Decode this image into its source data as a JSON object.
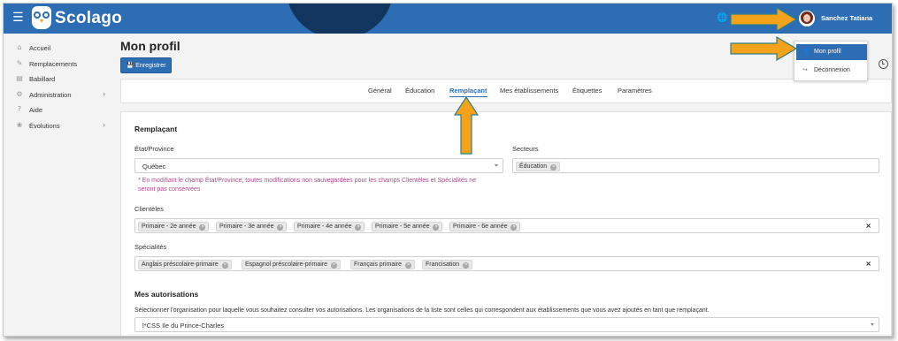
{
  "app": {
    "logo_text": "Scolago",
    "user_name": "Sanchez Tatiana"
  },
  "sidebar": {
    "items": [
      {
        "label": "Accueil",
        "icon": "home-icon",
        "has_submenu": false
      },
      {
        "label": "Remplacements",
        "icon": "pencil-icon",
        "has_submenu": false
      },
      {
        "label": "Babillard",
        "icon": "board-icon",
        "has_submenu": false
      },
      {
        "label": "Administration",
        "icon": "gear-icon",
        "has_submenu": true
      },
      {
        "label": "Aide",
        "icon": "question-icon",
        "has_submenu": false
      },
      {
        "label": "Évolutions",
        "icon": "sprout-icon",
        "has_submenu": true
      }
    ]
  },
  "page": {
    "title": "Mon profil",
    "save_label": "Enregistrer"
  },
  "tabs": [
    {
      "label": "Général",
      "active": false
    },
    {
      "label": "Éducation",
      "active": false
    },
    {
      "label": "Remplaçant",
      "active": true
    },
    {
      "label": "Mes établissements",
      "active": false
    },
    {
      "label": "Étiquettes",
      "active": false
    },
    {
      "label": "Paramètres",
      "active": false
    }
  ],
  "form": {
    "section_title": "Remplaçant",
    "state_label": "État/Province",
    "state_value": "Québec",
    "state_helper_1": "* En modifiant le champ État/Province, toutes modifications non sauvegardées pour les champs Clientèles et Spécialités ne",
    "state_helper_2": "seront pas conservées",
    "sectors_label": "Secteurs",
    "sectors": [
      "Éducation"
    ],
    "clienteles_label": "Clientèles",
    "clienteles": [
      "Primaire - 2e année",
      "Primaire - 3e année",
      "Primaire - 4e année",
      "Primaire - 5e année",
      "Primaire - 6e année"
    ],
    "specialities_label": "Spécialités",
    "specialities": [
      "Anglais préscolaire-primaire",
      "Espagnol préscolaire-primaire",
      "Français primaire",
      "Francisation"
    ]
  },
  "authorizations": {
    "title": "Mes autorisations",
    "description": "Sélectionner l'organisation pour laquelle vous souhaitez consulter vos autorisations. Les organisations de la liste sont celles qui correspondent aux établissements que vous avez ajoutés en tant que remplaçant.",
    "org_value": "l*CSS Ile du Prince-Charles"
  },
  "user_menu": {
    "items": [
      {
        "label": "Mon profil",
        "active": true
      },
      {
        "label": "Déconnexion",
        "active": false
      }
    ]
  },
  "colors": {
    "brand_blue": "#2d6db4",
    "helper_text": "#b04a8a",
    "annotation_arrow": "#f5a21b"
  }
}
